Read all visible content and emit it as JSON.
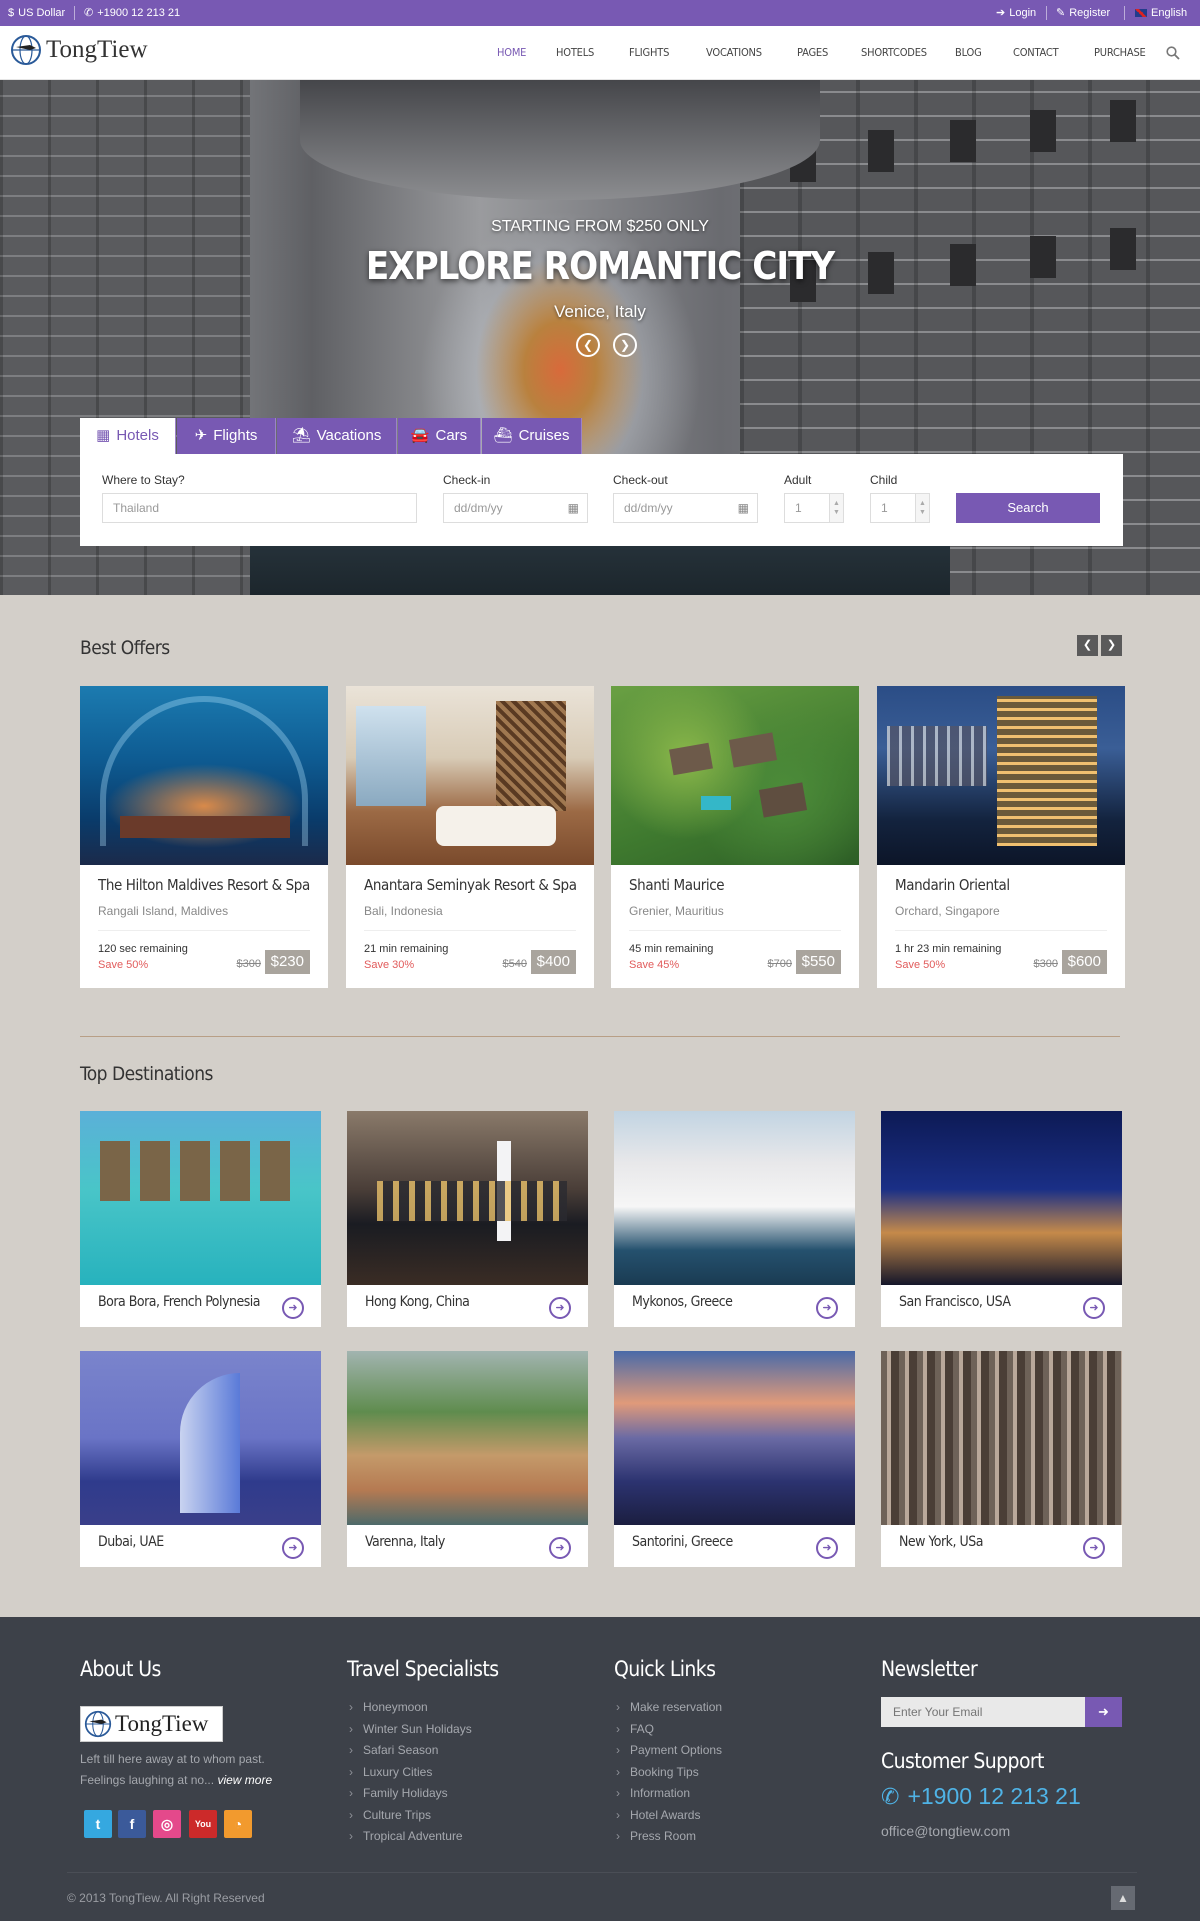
{
  "topbar": {
    "currency": "US Dollar",
    "phone": "+1900 12 213 21",
    "login": "Login",
    "register": "Register",
    "language": "English"
  },
  "header": {
    "logo_text": "TongTiew",
    "nav": [
      "HOME",
      "HOTELS",
      "FLIGHTS",
      "VOCATIONS",
      "PAGES",
      "SHORTCODES",
      "BLOG",
      "CONTACT",
      "PURCHASE"
    ]
  },
  "hero": {
    "subtitle": "STARTING FROM $250 ONLY",
    "title": "EXPLORE ROMANTIC CITY",
    "location": "Venice, Italy"
  },
  "search": {
    "tabs": [
      "Hotels",
      "Flights",
      "Vacations",
      "Cars",
      "Cruises"
    ],
    "active_tab": "Hotels",
    "where_label": "Where to Stay?",
    "where_value": "Thailand",
    "checkin_label": "Check-in",
    "checkin_placeholder": "dd/dm/yy",
    "checkout_label": "Check-out",
    "checkout_placeholder": "dd/dm/yy",
    "adult_label": "Adult",
    "adult_value": "1",
    "child_label": "Child",
    "child_value": "1",
    "button": "Search"
  },
  "best_offers": {
    "title": "Best Offers",
    "items": [
      {
        "name": "The Hilton Maldives Resort & Spa",
        "location": "Rangali Island, Maldives",
        "remaining": "120 sec remaining",
        "save": "Save 50%",
        "old_price": "$300",
        "price": "$230"
      },
      {
        "name": "Anantara Seminyak Resort & Spa",
        "location": "Bali, Indonesia",
        "remaining": "21 min remaining",
        "save": "Save 30%",
        "old_price": "$540",
        "price": "$400"
      },
      {
        "name": "Shanti Maurice",
        "location": "Grenier, Mauritius",
        "remaining": "45 min remaining",
        "save": "Save 45%",
        "old_price": "$700",
        "price": "$550"
      },
      {
        "name": "Mandarin Oriental",
        "location": "Orchard, Singapore",
        "remaining": "1 hr 23 min remaining",
        "save": "Save 50%",
        "old_price": "$300",
        "price": "$600"
      }
    ]
  },
  "top_destinations": {
    "title": "Top Destinations",
    "items": [
      "Bora Bora, French Polynesia",
      "Hong Kong, China",
      "Mykonos, Greece",
      "San Francisco, USA",
      "Dubai, UAE",
      "Varenna, Italy",
      "Santorini, Greece",
      "New York, USa"
    ]
  },
  "footer": {
    "about_title": "About Us",
    "about_logo": "TongTiew",
    "about_text_1": "Left till here away at to whom past.",
    "about_text_2": "Feelings laughing at no...",
    "view_more": "view more",
    "travel_title": "Travel Specialists",
    "travel_items": [
      "Honeymoon",
      "Winter Sun Holidays",
      "Safari Season",
      "Luxury Cities",
      "Family Holidays",
      "Culture Trips",
      "Tropical Adventure"
    ],
    "quick_title": "Quick Links",
    "quick_items": [
      "Make reservation",
      "FAQ",
      "Payment Options",
      "Booking Tips",
      "Information",
      "Hotel Awards",
      "Press Room"
    ],
    "newsletter_title": "Newsletter",
    "newsletter_placeholder": "Enter Your Email",
    "support_title": "Customer Support",
    "support_phone": "+1900 12 213 21",
    "support_email": "office@tongtiew.com",
    "copyright": "© 2013 TongTiew. All Right Reserved"
  },
  "colors": {
    "accent": "#7859b3",
    "footer_bg": "#3d4149",
    "page_bg": "#d3cfc9",
    "save_red": "#e15b5b",
    "phone_blue": "#4fb3e6"
  }
}
